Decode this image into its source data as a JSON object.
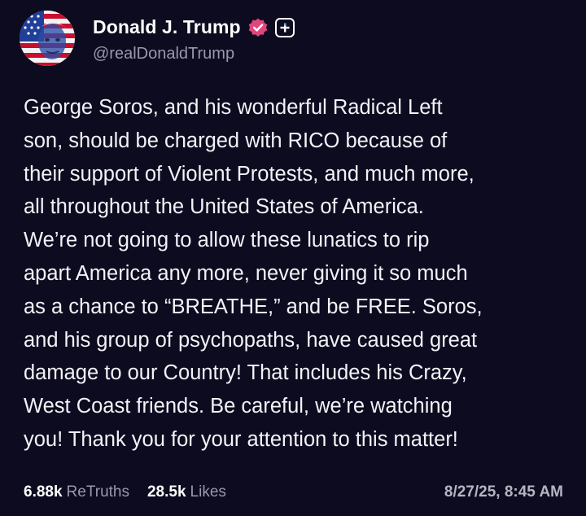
{
  "post": {
    "author": {
      "display_name": "Donald J. Trump",
      "handle": "@realDonaldTrump",
      "avatar_icon": "flag-portrait-avatar",
      "verified_icon": "verified-badge-icon",
      "verified_color": "#e0457b",
      "plus_icon": "plus-badge-icon"
    },
    "text": "George Soros, and his wonderful Radical Left\nson, should be charged with RICO because of\ntheir support of Violent Protests, and much more,\nall throughout the United States of America.\nWe’re not going to allow these lunatics to rip\napart America any more, never giving it so much\nas a chance to “BREATHE,” and be FREE. Soros,\nand his group of psychopaths, have caused great\ndamage to our Country! That includes his Crazy,\nWest Coast friends. Be careful, we’re watching\nyou! Thank you for your attention to this matter!",
    "stats": {
      "retruths_count": "6.88k",
      "retruths_label": "ReTruths",
      "likes_count": "28.5k",
      "likes_label": "Likes"
    },
    "timestamp": "8/27/25, 8:45 AM"
  },
  "colors": {
    "background": "#0d0b1f",
    "text": "#f3f2f7",
    "muted": "#9a98aa"
  }
}
